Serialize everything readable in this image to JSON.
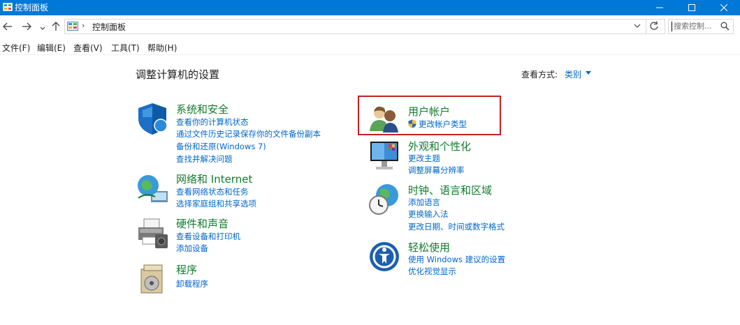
{
  "window": {
    "title": "控制面板",
    "icon": "control-panel-icon",
    "accent": "#0078d7"
  },
  "address": {
    "separator": "›",
    "path": "控制面板",
    "search_placeholder": "搜索控制..."
  },
  "menu": [
    "文件(F)",
    "编辑(E)",
    "查看(V)",
    "工具(T)",
    "帮助(H)"
  ],
  "main": {
    "heading": "调整计算机的设置",
    "view_by_label": "查看方式:",
    "view_by_value": "类别"
  },
  "categories_left": [
    {
      "title": "系统和安全",
      "icon": "shield-icon",
      "links": [
        "查看你的计算机状态",
        "通过文件历史记录保存你的文件备份副本",
        "备份和还原(Windows 7)",
        "查找并解决问题"
      ]
    },
    {
      "title": "网络和 Internet",
      "icon": "globe-network-icon",
      "links": [
        "查看网络状态和任务",
        "选择家庭组和共享选项"
      ]
    },
    {
      "title": "硬件和声音",
      "icon": "printer-icon",
      "links": [
        "查看设备和打印机",
        "添加设备"
      ]
    },
    {
      "title": "程序",
      "icon": "programs-icon",
      "links": [
        "卸载程序"
      ]
    }
  ],
  "categories_right": [
    {
      "title": "用户帐户",
      "icon": "users-icon",
      "links": [
        "更改帐户类型"
      ],
      "highlighted": true
    },
    {
      "title": "外观和个性化",
      "icon": "monitor-icon",
      "links": [
        "更改主题",
        "调整屏幕分辨率"
      ]
    },
    {
      "title": "时钟、语言和区域",
      "icon": "clock-globe-icon",
      "links": [
        "添加语言",
        "更换输入法",
        "更改日期、时间或数字格式"
      ]
    },
    {
      "title": "轻松使用",
      "icon": "ease-of-access-icon",
      "links": [
        "使用 Windows 建议的设置",
        "优化视觉显示"
      ]
    }
  ],
  "colors": {
    "category_title": "#0f7b2c",
    "link": "#0066cc",
    "highlight": "#c42121"
  }
}
